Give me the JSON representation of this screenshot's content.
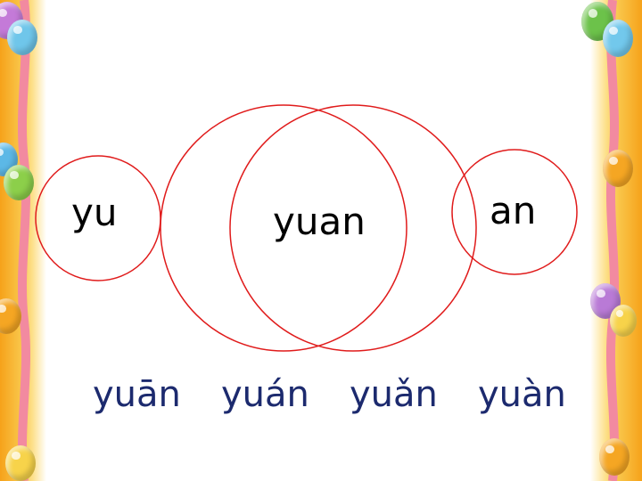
{
  "diagram": {
    "left_syllable": "yu",
    "center_syllable": "yuan",
    "right_syllable": "an",
    "circle_color": "#e01b1b"
  },
  "tones": [
    "yuān",
    "yuán",
    "yuǎn",
    "yuàn"
  ],
  "colors": {
    "tone_text": "#1c2a6e",
    "border_orange": "#f6a21a",
    "ribbon_pink": "#f28aa0"
  },
  "decorations": {
    "left_balloons": [
      "purple-balloon",
      "blue-balloon",
      "blue-balloon",
      "green-balloon",
      "orange-balloon",
      "yellow-balloon"
    ],
    "right_balloons": [
      "green-balloon",
      "blue-balloon",
      "orange-balloon",
      "purple-balloon",
      "yellow-balloon",
      "orange-balloon"
    ]
  }
}
